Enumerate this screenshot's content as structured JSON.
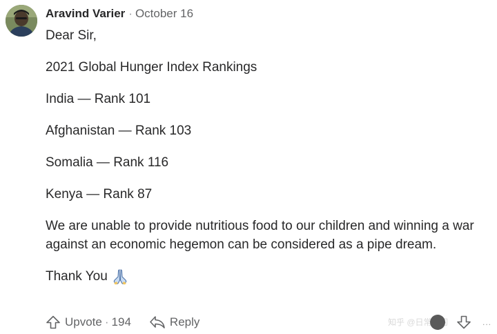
{
  "comment": {
    "author": "Aravind Varier",
    "separator": "·",
    "date": "October 16",
    "paragraphs": [
      "Dear Sir,",
      "2021 Global Hunger Index Rankings",
      "India — Rank 101",
      "Afghanistan — Rank 103",
      "Somalia — Rank 116",
      "Kenya — Rank 87",
      "We are unable to provide nutritious food to our children and winning a war against an economic hegemon can be considered as a pipe dream."
    ],
    "closing": "Thank You",
    "closing_emoji": "folded-hands-icon"
  },
  "actions": {
    "upvote_label": "Upvote",
    "separator": "·",
    "upvote_count": "194",
    "reply_label": "Reply",
    "more_label": "...",
    "watermark": "知乎 @日常学习"
  },
  "colors": {
    "text": "#282829",
    "meta": "#636466",
    "background": "#ffffff"
  }
}
